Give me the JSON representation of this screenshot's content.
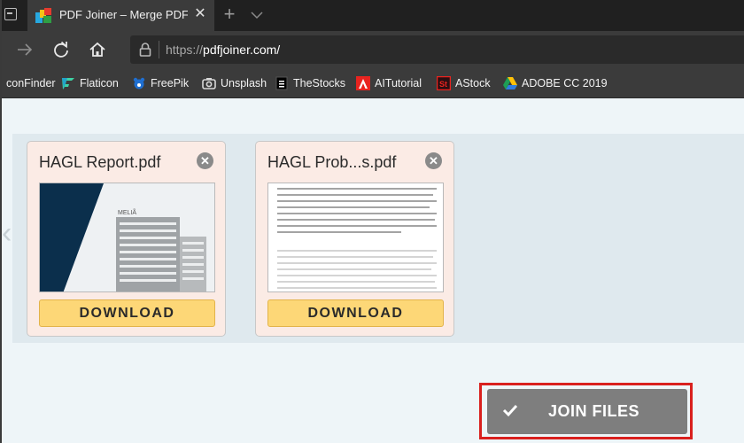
{
  "browser": {
    "tab_title": "PDF Joiner – Merge PDF",
    "close_glyph": "✕",
    "new_tab_glyph": "+",
    "url_protocol": "https://",
    "url_host": "pdfjoiner.com/"
  },
  "bookmarks": [
    {
      "label": "conFinder",
      "icon": "iconfinder-icon"
    },
    {
      "label": "Flaticon",
      "icon": "flaticon-icon"
    },
    {
      "label": "FreePik",
      "icon": "freepik-icon"
    },
    {
      "label": "Unsplash",
      "icon": "unsplash-icon"
    },
    {
      "label": "TheStocks",
      "icon": "thestocks-icon"
    },
    {
      "label": "AITutorial",
      "icon": "adobe-icon"
    },
    {
      "label": "AStock",
      "icon": "adobe-stock-icon"
    },
    {
      "label": "ADOBE CC 2019",
      "icon": "google-drive-icon"
    }
  ],
  "files": [
    {
      "name": "HAGL Report.pdf",
      "download_label": "DOWNLOAD",
      "remove_glyph": "✕",
      "thumb_text": "MELIÃ"
    },
    {
      "name": "HAGL Prob...s.pdf",
      "download_label": "DOWNLOAD",
      "remove_glyph": "✕"
    }
  ],
  "join_button": {
    "label": "JOIN FILES"
  },
  "colors": {
    "download_button": "#fdd777",
    "file_card": "#fbebe5",
    "join_button": "#7e7e7e",
    "highlight_outline": "#d9201e"
  }
}
